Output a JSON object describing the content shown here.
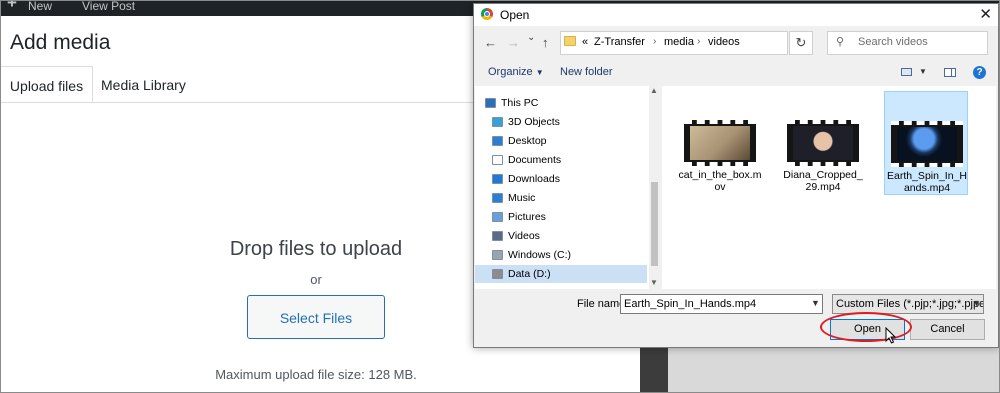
{
  "adminbar": {
    "plus": "+",
    "new_label": "New",
    "view_post_label": "View Post"
  },
  "media_modal": {
    "title": "Add media",
    "tabs": [
      {
        "label": "Upload files"
      },
      {
        "label": "Media Library"
      }
    ],
    "drop_text": "Drop files to upload",
    "or_text": "or",
    "select_files_label": "Select Files",
    "max_size_text": "Maximum upload file size: 128 MB."
  },
  "dialog": {
    "title": "Open",
    "close_glyph": "✕",
    "nav_glyphs": {
      "back": "←",
      "forward": "→",
      "dropdown": "⌄",
      "up": "↑"
    },
    "breadcrumb": {
      "prefix": "«",
      "items": [
        "Z-Transfer",
        "media",
        "videos"
      ],
      "separator": "›"
    },
    "refresh_glyph": "↻",
    "search_placeholder": "Search videos",
    "toolbar": {
      "organize_label": "Organize",
      "new_folder_label": "New folder",
      "help_glyph": "?"
    },
    "nav_items": [
      {
        "label": "This PC",
        "icon": "computer-icon",
        "color": "#2b6fb8"
      },
      {
        "label": "3D Objects",
        "icon": "cube-icon",
        "color": "#35a3d8"
      },
      {
        "label": "Desktop",
        "icon": "desktop-icon",
        "color": "#2a7fd4"
      },
      {
        "label": "Documents",
        "icon": "document-icon",
        "color": "#ffffff"
      },
      {
        "label": "Downloads",
        "icon": "download-icon",
        "color": "#1e7ad6"
      },
      {
        "label": "Music",
        "icon": "music-icon",
        "color": "#2a7fd4"
      },
      {
        "label": "Pictures",
        "icon": "picture-icon",
        "color": "#6aa0d8"
      },
      {
        "label": "Videos",
        "icon": "video-icon",
        "color": "#5b6b86"
      },
      {
        "label": "Windows (C:)",
        "icon": "drive-c-icon",
        "color": "#9aa4ad"
      },
      {
        "label": "Data (D:)",
        "icon": "drive-d-icon",
        "color": "#8c8c8c"
      }
    ],
    "selected_nav": "Data (D:)",
    "files": [
      {
        "name": "cat_in_the_box.mov",
        "selected": false,
        "thumb": "cat"
      },
      {
        "name": "Diana_Cropped_29.mp4",
        "selected": false,
        "thumb": "diana"
      },
      {
        "name": "Earth_Spin_In_Hands.mp4",
        "selected": true,
        "thumb": "earth"
      }
    ],
    "file_name_label": "File name:",
    "file_name_value": "Earth_Spin_In_Hands.mp4",
    "filter_value": "Custom Files (*.pjp;*.jpg;*.pjpeg",
    "open_label": "Open",
    "cancel_label": "Cancel"
  },
  "colors": {
    "accent": "#2271b1",
    "highlight_ring": "#e01b1b",
    "selection": "#cce8ff"
  }
}
